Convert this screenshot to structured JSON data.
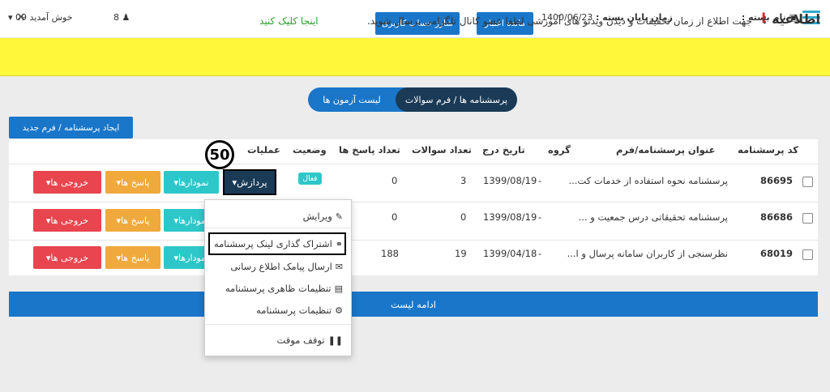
{
  "header": {
    "package_label": "نام بسته :",
    "end_time_label": "زمان پایان بسته :",
    "end_date": "1400/06/23",
    "credit_button": "مانده اعتبار",
    "charge_button": "شارژ حساب کاربری",
    "user_count": "8",
    "welcome_text": "09 خوش آمدید"
  },
  "alert": {
    "title": "اطلاعیه :",
    "exclaim": "!",
    "message": "جهت اطلاع از زمان تخفیفات و دیدن ویدئو های آموزشی لطفا عضو کانال تلگرامی پرسال شوید.",
    "link_text": "اینجا کلیک کنید",
    "close": "×"
  },
  "tabs": {
    "active": "پرسشنامه ها / فرم سوالات",
    "other": "لیست آزمون ها"
  },
  "new_form_button": "ایجاد پرسشنامه / فرم جدید",
  "table": {
    "columns": {
      "code": "کد پرسشنامه",
      "title": "عنوان پرسشنامه/فرم",
      "group": "گروه",
      "date": "تاریخ درج",
      "questions": "تعداد سوالات",
      "answers": "تعداد پاسخ ها",
      "status": "وضعیت",
      "operations": "عملیات"
    },
    "rows": [
      {
        "code": "86695",
        "title": "پرسشنامه نحوه استفاده از خدمات کت...",
        "group": "-",
        "date": "1399/08/19",
        "questions": "3",
        "answers": "0",
        "status": "فعال"
      },
      {
        "code": "86686",
        "title": "پرسشنامه تحقیقاتی درس جمعیت و ...",
        "group": "-",
        "date": "1399/08/19",
        "questions": "0",
        "answers": "0",
        "status": ""
      },
      {
        "code": "68019",
        "title": "نظرسنجی از کاربران سامانه پرسال و ا...",
        "group": "-",
        "date": "1399/04/18",
        "questions": "19",
        "answers": "188",
        "status": ""
      }
    ],
    "buttons": {
      "process": "پردازش",
      "charts": "نمودارها",
      "answers": "پاسخ ها",
      "outputs": "خروجی ها"
    }
  },
  "annotation": "50",
  "dropdown": {
    "items": [
      {
        "label": "ویرایش",
        "icon": "edit-icon"
      },
      {
        "label": "اشتراک گذاری لینک پرسشنامه",
        "icon": "link-icon"
      },
      {
        "label": "ارسال پیامک اطلاع رسانی",
        "icon": "envelope-icon"
      },
      {
        "label": "تنظیمات ظاهری پرسشنامه",
        "icon": "image-icon"
      },
      {
        "label": "تنظیمات پرسشنامه",
        "icon": "gears-icon"
      },
      {
        "label": "توقف موقت",
        "icon": "pause-icon"
      }
    ]
  },
  "continue_bar": "ادامه لیست",
  "colors": {
    "primary": "#1976c9",
    "dark": "#1a3a56",
    "teal": "#2ec7c9",
    "orange": "#f0a93c",
    "red": "#e8454f",
    "alert_bg": "#fff83a"
  }
}
